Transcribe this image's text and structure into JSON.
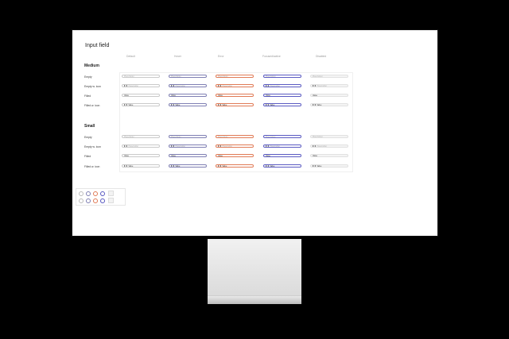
{
  "page": {
    "title": "Input field"
  },
  "columns": [
    "Default",
    "Hover",
    "Error",
    "Focused/active",
    "Disabled"
  ],
  "sections": [
    {
      "label": "Medium",
      "rows": [
        "Empty",
        "Empty w. icon",
        "Filled",
        "Filled w. icon"
      ]
    },
    {
      "label": "Small",
      "rows": [
        "Empty",
        "Empty w. icon",
        "Filled",
        "Filled w. icon"
      ]
    }
  ],
  "field_text": {
    "placeholder": "Placeholder",
    "value": "Value"
  },
  "colors": {
    "default": "#c9c9c9",
    "hover": "#7f7fb3",
    "error": "#e07a55",
    "focus": "#5a5ac2",
    "disabled": "#e1e1e1"
  }
}
